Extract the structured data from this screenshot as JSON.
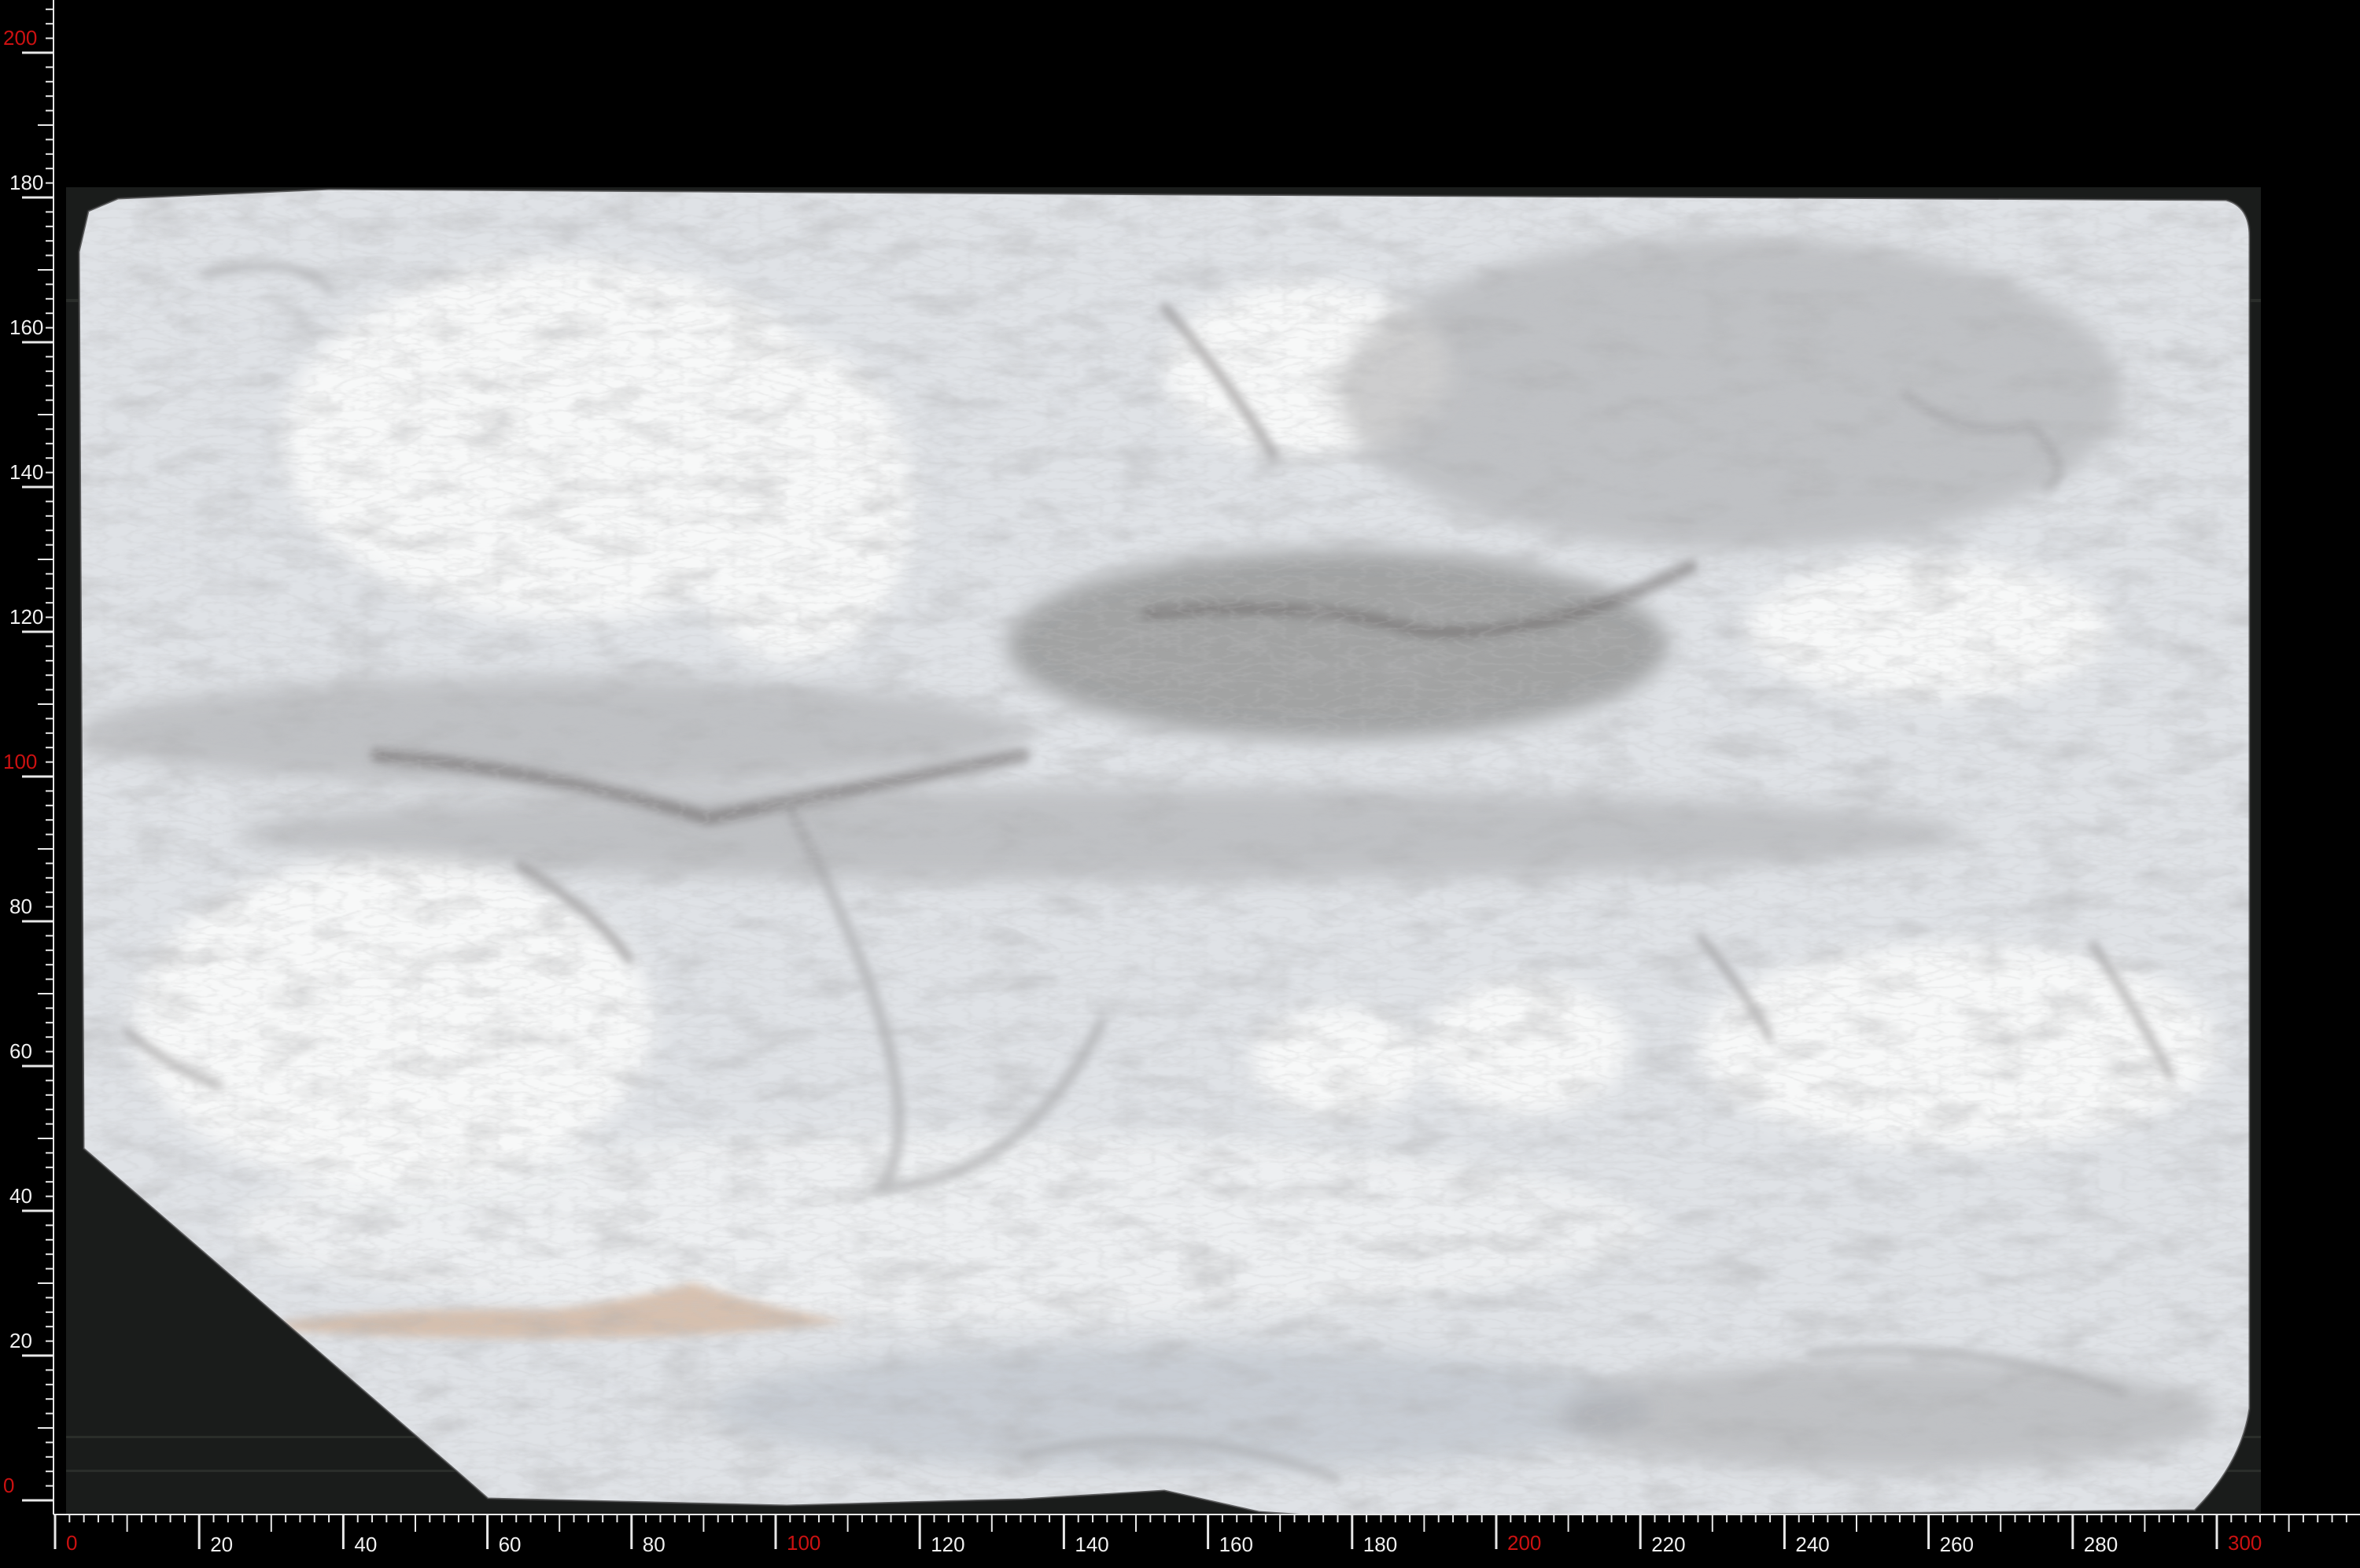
{
  "ruler": {
    "unit_label": "",
    "x_labels": [
      {
        "value": 0,
        "text": "0",
        "major": true
      },
      {
        "value": 20,
        "text": "20",
        "major": false
      },
      {
        "value": 40,
        "text": "40",
        "major": false
      },
      {
        "value": 60,
        "text": "60",
        "major": false
      },
      {
        "value": 80,
        "text": "80",
        "major": false
      },
      {
        "value": 100,
        "text": "100",
        "major": true
      },
      {
        "value": 120,
        "text": "120",
        "major": false
      },
      {
        "value": 140,
        "text": "140",
        "major": false
      },
      {
        "value": 160,
        "text": "160",
        "major": false
      },
      {
        "value": 180,
        "text": "180",
        "major": false
      },
      {
        "value": 200,
        "text": "200",
        "major": true
      },
      {
        "value": 220,
        "text": "220",
        "major": false
      },
      {
        "value": 240,
        "text": "240",
        "major": false
      },
      {
        "value": 260,
        "text": "260",
        "major": false
      },
      {
        "value": 280,
        "text": "280",
        "major": false
      },
      {
        "value": 300,
        "text": "300",
        "major": true
      }
    ],
    "y_labels": [
      {
        "value": 0,
        "text": "0",
        "major": true
      },
      {
        "value": 20,
        "text": "20",
        "major": false
      },
      {
        "value": 40,
        "text": "40",
        "major": false
      },
      {
        "value": 60,
        "text": "60",
        "major": false
      },
      {
        "value": 80,
        "text": "80",
        "major": false
      },
      {
        "value": 100,
        "text": "100",
        "major": true
      },
      {
        "value": 120,
        "text": "120",
        "major": false
      },
      {
        "value": 140,
        "text": "140",
        "major": false
      },
      {
        "value": 160,
        "text": "160",
        "major": false
      },
      {
        "value": 180,
        "text": "180",
        "major": false
      },
      {
        "value": 200,
        "text": "200",
        "major": true
      }
    ],
    "x_range": [
      0,
      320
    ],
    "y_range": [
      0,
      208
    ],
    "colors": {
      "major_label": "#cc1111",
      "minor_label": "#f0f0f0",
      "tick": "#e8e8e8",
      "background": "#000000"
    }
  },
  "slab": {
    "material": "marble-slab-icon",
    "colors": {
      "base": "#dfe2e6",
      "white_zone": "#f7f8f8",
      "grey_vein": "#9a9a9c",
      "dark_vein": "#6f6d6c",
      "beige_vein": "#d3b9a5",
      "edge_shadow": "#3a3a3a"
    }
  }
}
